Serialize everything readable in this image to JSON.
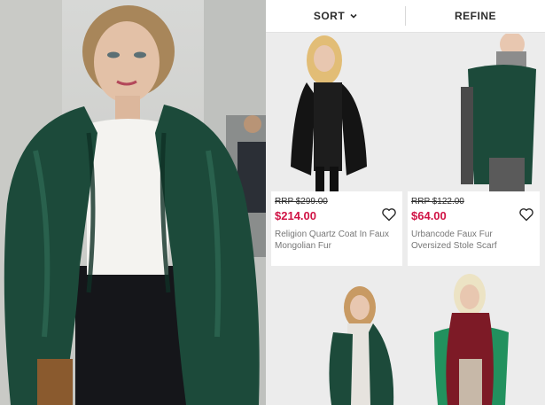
{
  "toolbar": {
    "sort_label": "SORT",
    "refine_label": "REFINE"
  },
  "products": [
    {
      "old_price": "RRP $299.00",
      "price": "$214.00",
      "name": "Religion Quartz Coat In Faux Mongolian Fur"
    },
    {
      "old_price": "RRP $122.00",
      "price": "$64.00",
      "name": "Urbancode Faux Fur Oversized Stole Scarf"
    }
  ],
  "colors": {
    "price_red": "#d01345",
    "fur_green": "#1c4a3a",
    "fur_black": "#141414",
    "fur_burgundy": "#7d1a26"
  }
}
